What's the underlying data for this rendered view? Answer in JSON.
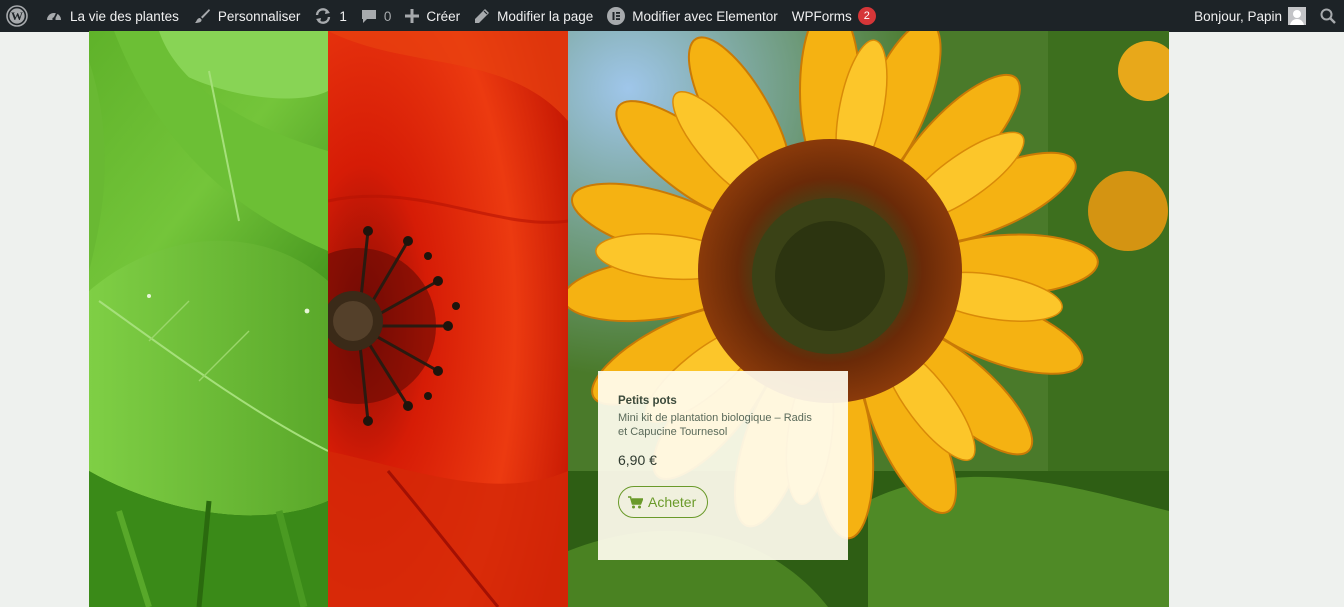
{
  "adminbar": {
    "site_name": "La vie des plantes",
    "customize": "Personnaliser",
    "updates_count": "1",
    "comments_count": "0",
    "new": "Créer",
    "edit_page": "Modifier la page",
    "edit_elementor": "Modifier avec Elementor",
    "wpforms": "WPForms",
    "wpforms_badge": "2",
    "greeting": "Bonjour, Papin"
  },
  "product": {
    "category": "Petits pots",
    "title": "Mini kit de plantation biologique – Radis et Capucine Tournesol",
    "price": "6,90 €",
    "button": "Acheter"
  },
  "colors": {
    "adminbar_bg": "#1d2327",
    "accent_green": "#6a9a2a",
    "badge_red": "#d63638"
  }
}
